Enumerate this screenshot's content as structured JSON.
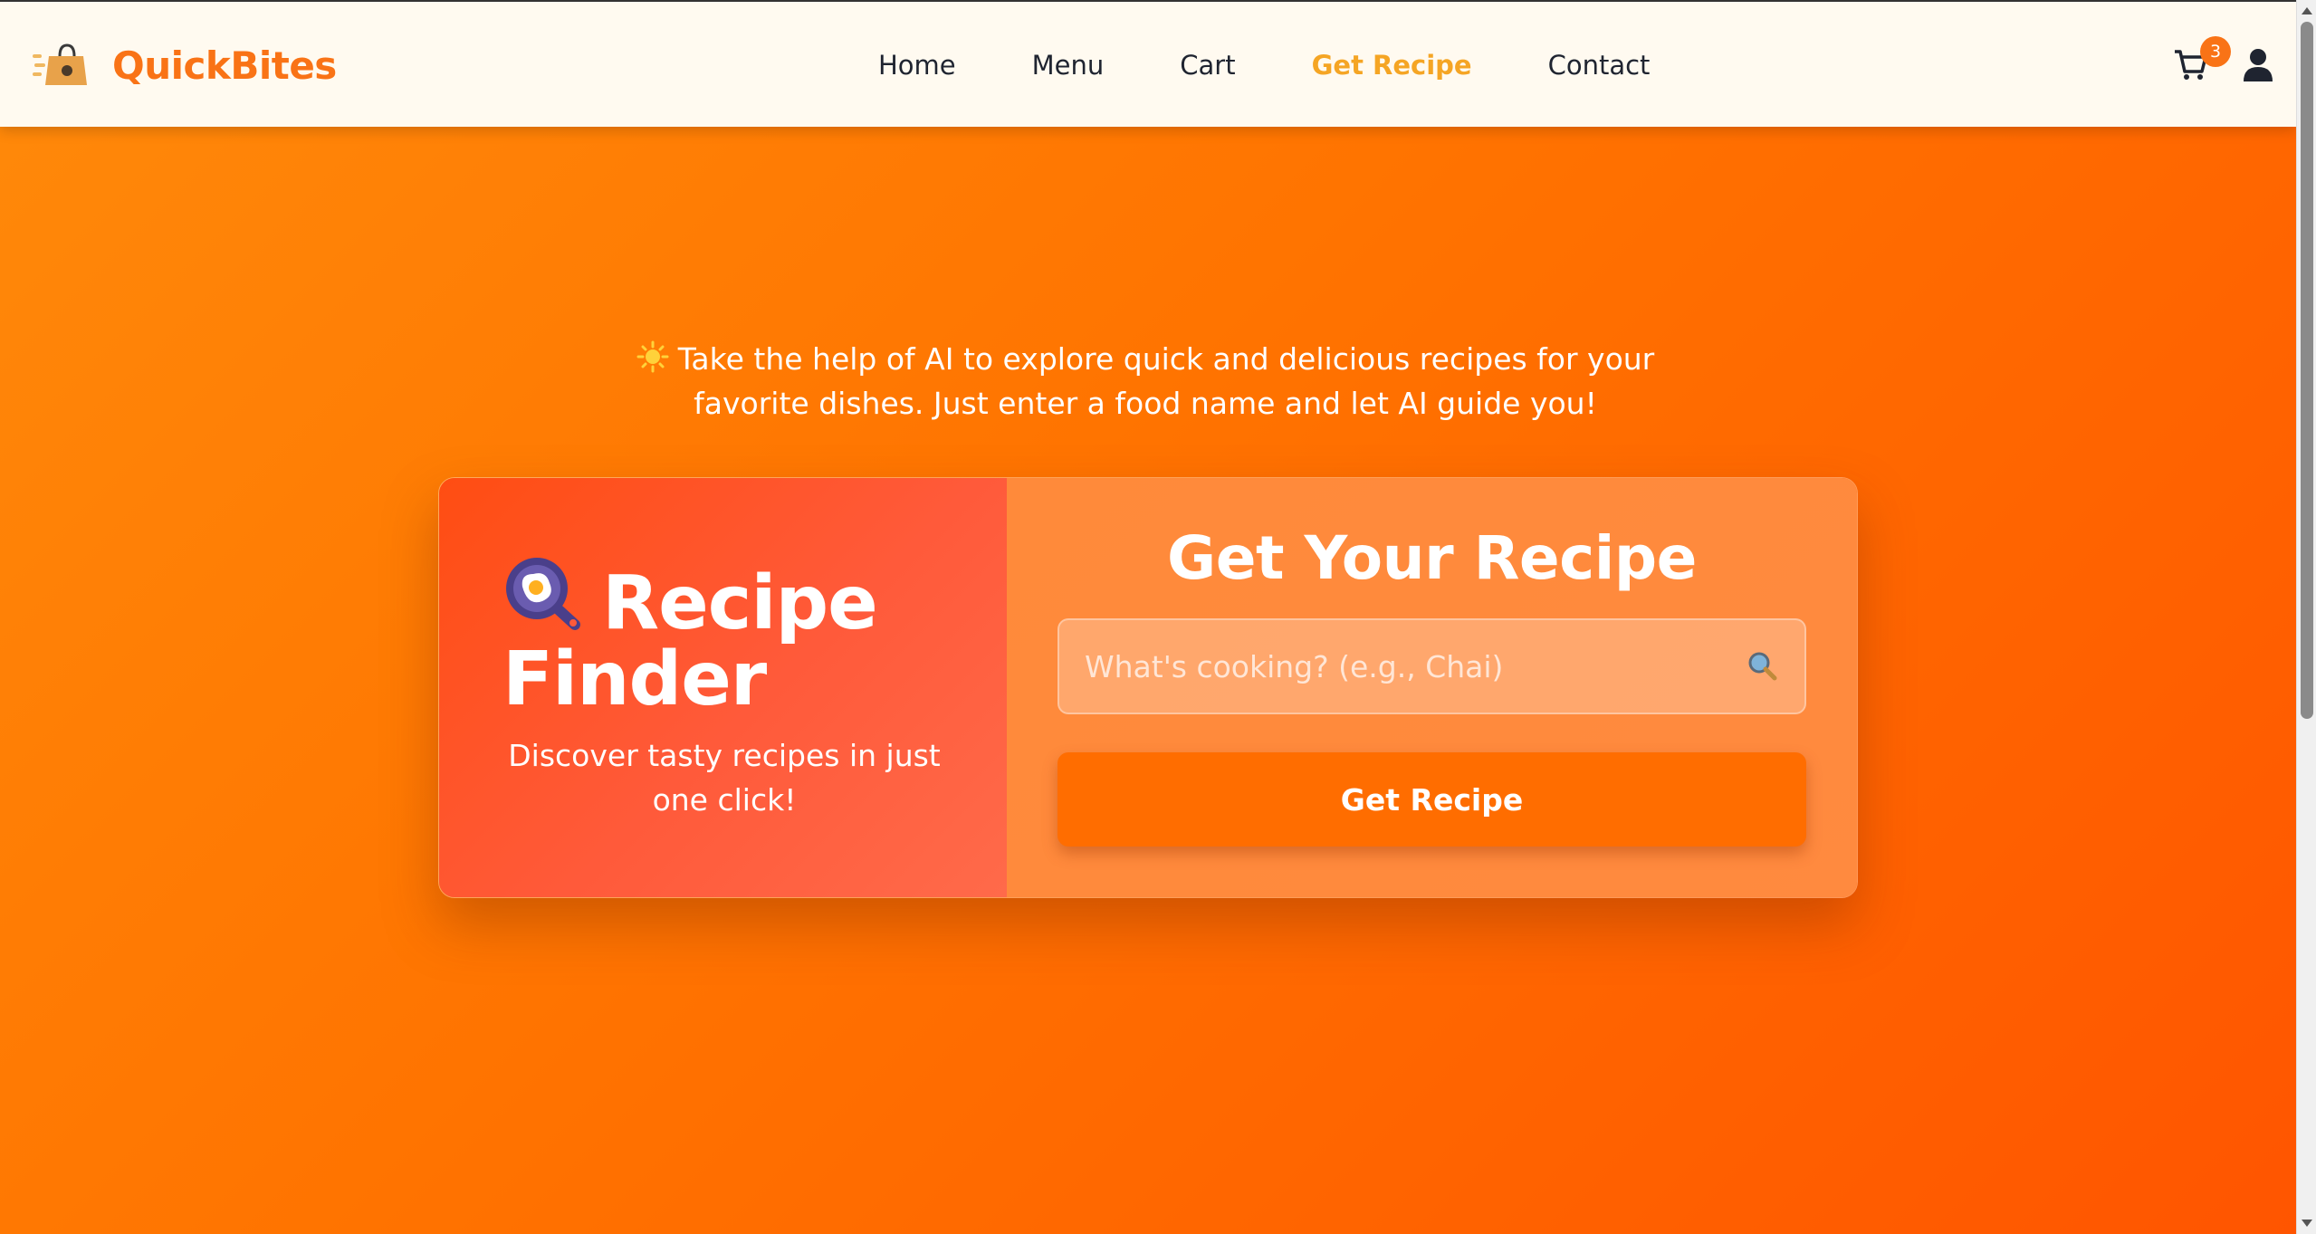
{
  "header": {
    "brand": "QuickBites",
    "nav": [
      {
        "label": "Home",
        "active": false
      },
      {
        "label": "Menu",
        "active": false
      },
      {
        "label": "Cart",
        "active": false
      },
      {
        "label": "Get Recipe",
        "active": true
      },
      {
        "label": "Contact",
        "active": false
      }
    ],
    "cart_count": "3"
  },
  "intro": {
    "text": "Take the help of AI to explore quick and delicious recipes for your favorite dishes. Just enter a food name and let AI guide you!",
    "icon": "sparkle-icon"
  },
  "card": {
    "left": {
      "title": "Recipe Finder",
      "subtitle": "Discover tasty recipes in just one click!",
      "icon": "frying-pan-egg-icon"
    },
    "right": {
      "title": "Get Your Recipe",
      "search_placeholder": "What's cooking? (e.g., Chai)",
      "search_value": "",
      "button_label": "Get Recipe"
    }
  },
  "colors": {
    "accent": "#f97316",
    "active_nav": "#f5a524",
    "header_bg": "#fffaf0",
    "button": "#ff6d00"
  }
}
